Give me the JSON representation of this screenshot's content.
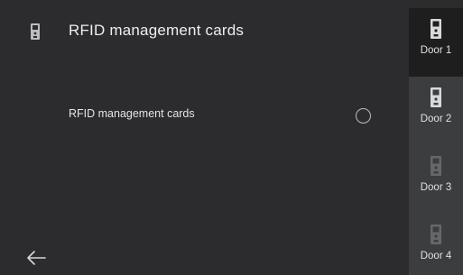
{
  "header": {
    "icon": "door-station-icon",
    "title": "RFID management cards"
  },
  "setting": {
    "label": "RFID management cards",
    "selected": false
  },
  "nav": {
    "back_icon": "back-arrow-icon"
  },
  "doors": [
    {
      "label": "Door 1",
      "active": true
    },
    {
      "label": "Door 2",
      "active": false
    },
    {
      "label": "Door 3",
      "active": false
    },
    {
      "label": "Door 4",
      "active": false
    }
  ]
}
